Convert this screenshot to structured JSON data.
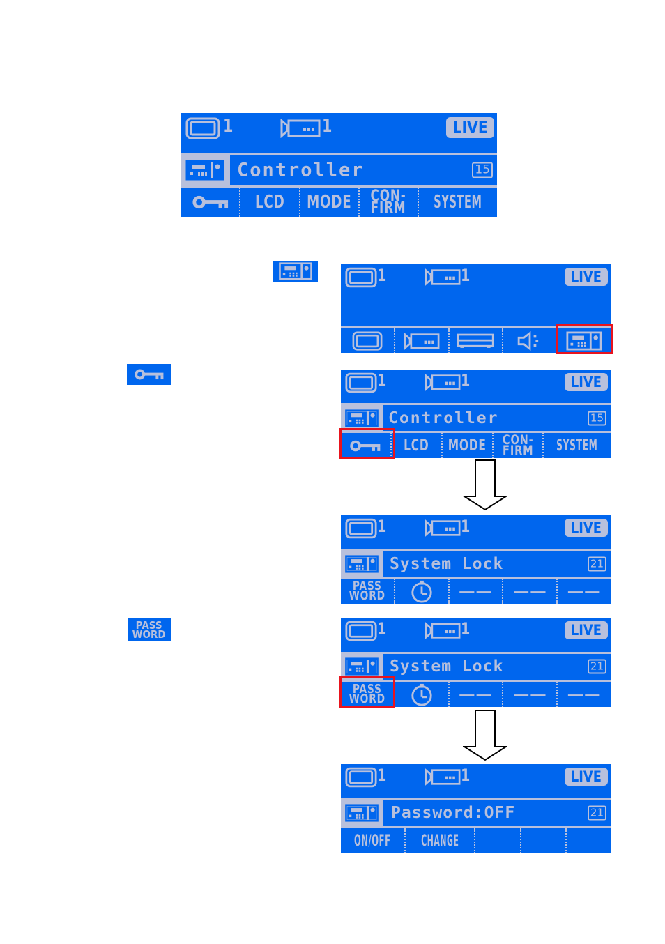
{
  "colors": {
    "lcd_bg": "#0066EE",
    "lcd_fg": "#B8C0DC",
    "highlight": "#E8141E"
  },
  "status_bar": {
    "monitor_number": "1",
    "camera_number": "1",
    "live_label": "LIVE"
  },
  "inline_icons": {
    "controller": "controller-icon",
    "key": "key-icon",
    "password": {
      "line1": "PASS",
      "line2": "WORD"
    }
  },
  "screens": {
    "s1": {
      "title": "Controller",
      "menu_number": "15",
      "softkeys": [
        {
          "icon": "key-icon"
        },
        {
          "label": "LCD"
        },
        {
          "label": "MODE"
        },
        {
          "line1": "CON-",
          "line2": "FIRM"
        },
        {
          "label": "SYSTEM"
        }
      ]
    },
    "s2": {
      "softkeys": [
        "monitor-icon",
        "camera-icon",
        "recorder-icon",
        "speaker-icon",
        "controller-icon"
      ],
      "highlighted": 4
    },
    "s3": {
      "title": "Controller",
      "menu_number": "15",
      "softkeys": [
        {
          "icon": "key-icon"
        },
        {
          "label": "LCD"
        },
        {
          "label": "MODE"
        },
        {
          "line1": "CON-",
          "line2": "FIRM"
        },
        {
          "label": "SYSTEM"
        }
      ],
      "highlighted": 0
    },
    "s4": {
      "title": "System Lock",
      "menu_number": "21",
      "softkeys": [
        {
          "line1": "PASS",
          "line2": "WORD"
        },
        {
          "icon": "timer-icon"
        },
        {
          "dash": "——"
        },
        {
          "dash": "——"
        },
        {
          "dash": "——"
        }
      ]
    },
    "s5": {
      "title": "System Lock",
      "menu_number": "21",
      "softkeys": [
        {
          "line1": "PASS",
          "line2": "WORD"
        },
        {
          "icon": "timer-icon"
        },
        {
          "dash": "——"
        },
        {
          "dash": "——"
        },
        {
          "dash": "——"
        }
      ],
      "highlighted": 0
    },
    "s6": {
      "title": "Password:OFF",
      "menu_number": "21",
      "softkeys": [
        {
          "label": "ON/OFF"
        },
        {
          "label": "CHANGE"
        },
        {
          "label": ""
        },
        {
          "label": ""
        },
        {
          "label": ""
        }
      ]
    }
  }
}
